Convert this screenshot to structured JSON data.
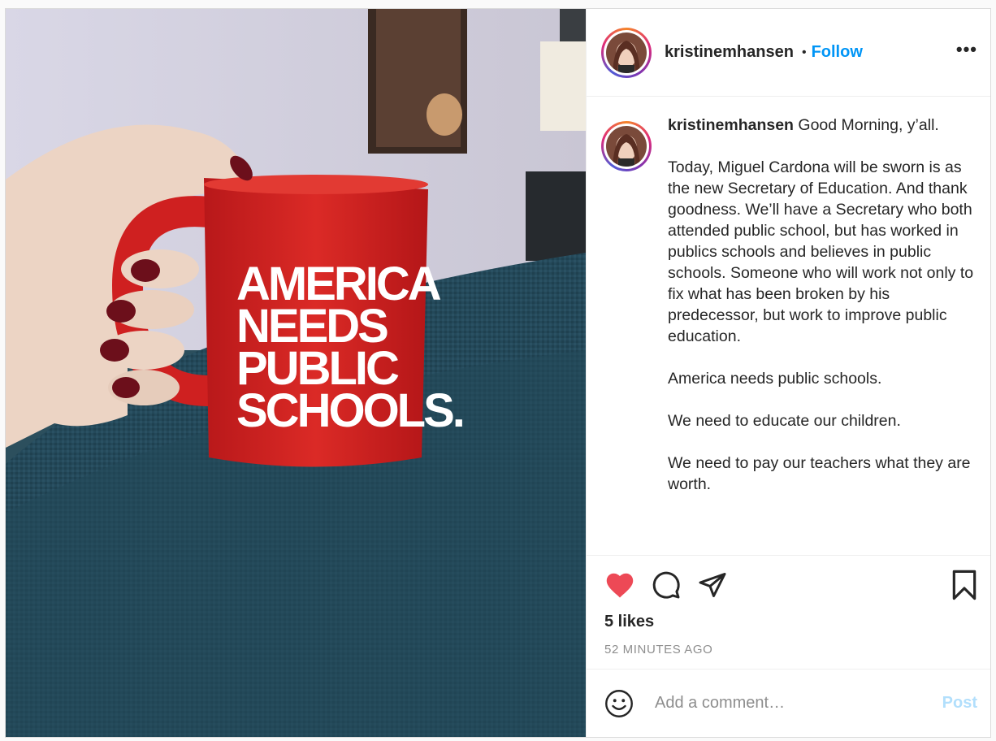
{
  "post": {
    "username": "kristinemhansen",
    "separator": "•",
    "follow_label": "Follow",
    "more_label": "•••",
    "image_alt": "Hand holding a red mug",
    "mug_text": [
      "AMERICA",
      "NEEDS",
      "PUBLIC",
      "SCHOOLS."
    ]
  },
  "caption": {
    "username": "kristinemhansen",
    "first_line": " Good Morning, y’all.",
    "paragraphs": [
      "Today, Miguel Cardona will be sworn is as the new Secretary of Education. And thank goodness. We’ll have a Secretary who both attended public school, but has worked in publics schools and believes in public schools. Someone who will work not only to fix what has been broken by his predecessor, but work to improve public education.",
      "America needs public schools.",
      "We need to educate our children.",
      "We need to pay our teachers what they are worth."
    ]
  },
  "actions": {
    "liked": true,
    "like_color": "#ed4956",
    "likes_text": "5 likes",
    "timestamp": "52 MINUTES AGO"
  },
  "comment": {
    "placeholder": "Add a comment…",
    "post_label": "Post"
  },
  "colors": {
    "follow": "#0095f6",
    "post_disabled": "#b2dffc",
    "mug": "#d7201f"
  }
}
